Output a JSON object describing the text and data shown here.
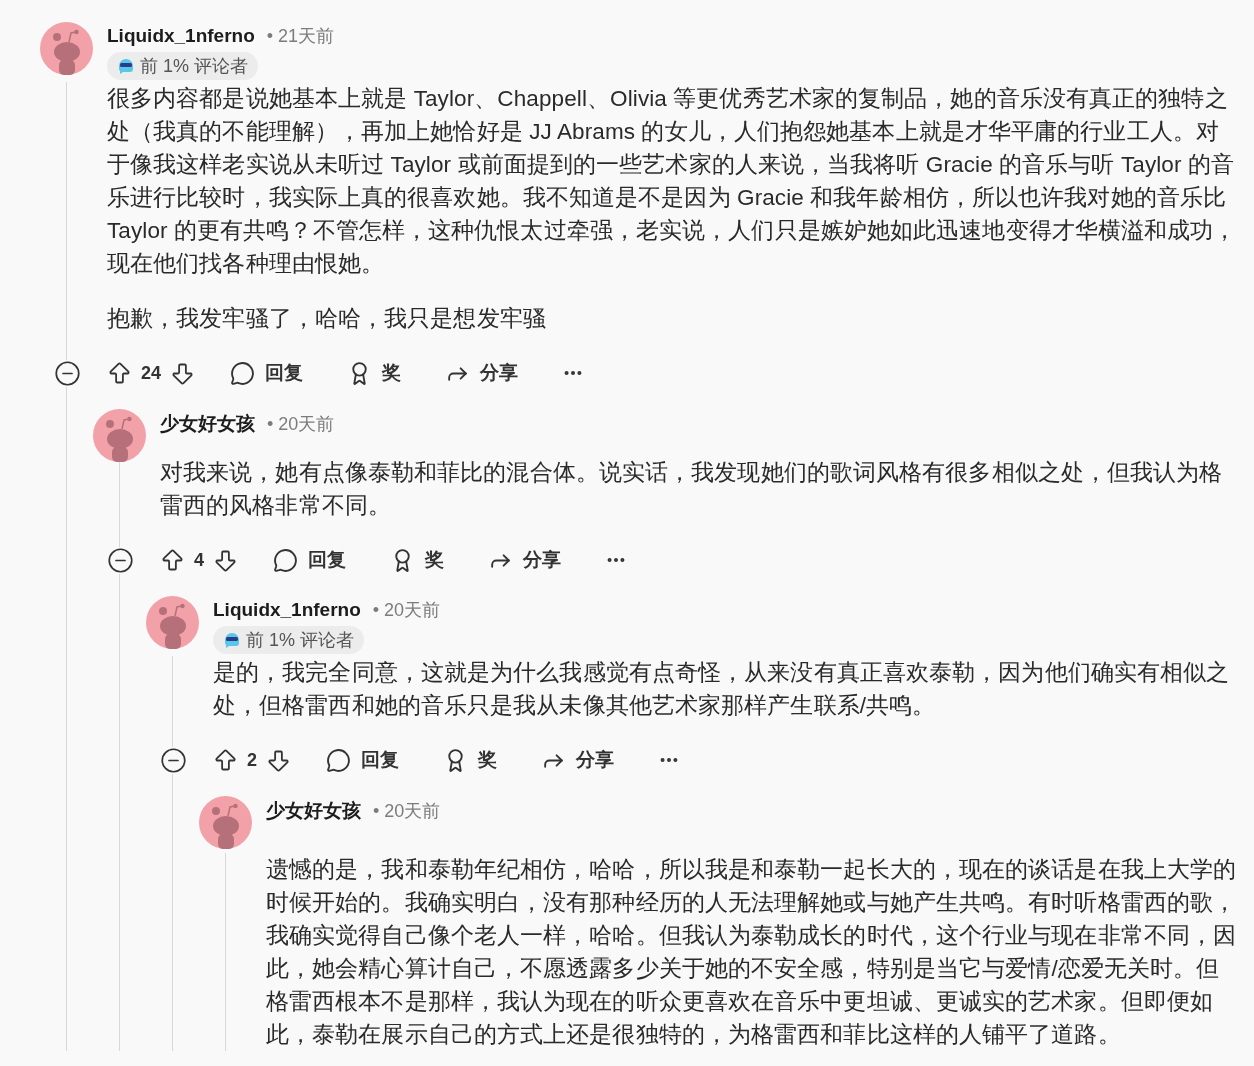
{
  "comments": [
    {
      "author": "Liquidx_1nferno",
      "time": "• 21天前",
      "badge": "前 1% 评论者",
      "paragraphs": [
        "很多内容都是说她基本上就是 Taylor、Chappell、Olivia 等更优秀艺术家的复制品，她的音乐没有真正的独特之处（我真的不能理解），再加上她恰好是 JJ Abrams 的女儿，人们抱怨她基本上就是才华平庸的行业工人。对于像我这样老实说从未听过 Taylor 或前面提到的一些艺术家的人来说，当我将听 Gracie 的音乐与听 Taylor 的音乐进行比较时，我实际上真的很喜欢她。我不知道是不是因为 Gracie 和我年龄相仿，所以也许我对她的音乐比 Taylor 的更有共鸣？不管怎样，这种仇恨太过牵强，老实说，人们只是嫉妒她如此迅速地变得才华横溢和成功，现在他们找各种理由恨她。",
        "抱歉，我发牢骚了，哈哈，我只是想发牢骚"
      ],
      "actions": {
        "votes": "24",
        "reply": "回复",
        "award": "奖",
        "share": "分享"
      },
      "children": [
        {
          "author": "少女好女孩",
          "time": "• 20天前",
          "paragraphs": [
            "对我来说，她有点像泰勒和菲比的混合体。说实话，我发现她们的歌词风格有很多相似之处，但我认为格雷西的风格非常不同。"
          ],
          "actions": {
            "votes": "4",
            "reply": "回复",
            "award": "奖",
            "share": "分享"
          },
          "children": [
            {
              "author": "Liquidx_1nferno",
              "time": "• 20天前",
              "badge": "前 1% 评论者",
              "paragraphs": [
                "是的，我完全同意，这就是为什么我感觉有点奇怪，从来没有真正喜欢泰勒，因为他们确实有相似之处，但格雷西和她的音乐只是我从未像其他艺术家那样产生联系/共鸣。"
              ],
              "actions": {
                "votes": "2",
                "reply": "回复",
                "award": "奖",
                "share": "分享"
              },
              "children": [
                {
                  "author": "少女好女孩",
                  "time": "• 20天前",
                  "paragraphs": [
                    "遗憾的是，我和泰勒年纪相仿，哈哈，所以我是和泰勒一起长大的，现在的谈话是在我上大学的时候开始的。我确实明白，没有那种经历的人无法理解她或与她产生共鸣。有时听格雷西的歌，我确实觉得自己像个老人一样，哈哈。但我认为泰勒成长的时代，这个行业与现在非常不同，因此，她会精心算计自己，不愿透露多少关于她的不安全感，特别是当它与爱情/恋爱无关时。但格雷西根本不是那样，我认为现在的听众更喜欢在音乐中更坦诚、更诚实的艺术家。但即便如此，泰勒在展示自己的方式上还是很独特的，为格雷西和菲比这样的人铺平了道路。"
                  ]
                }
              ]
            }
          ]
        }
      ]
    }
  ]
}
